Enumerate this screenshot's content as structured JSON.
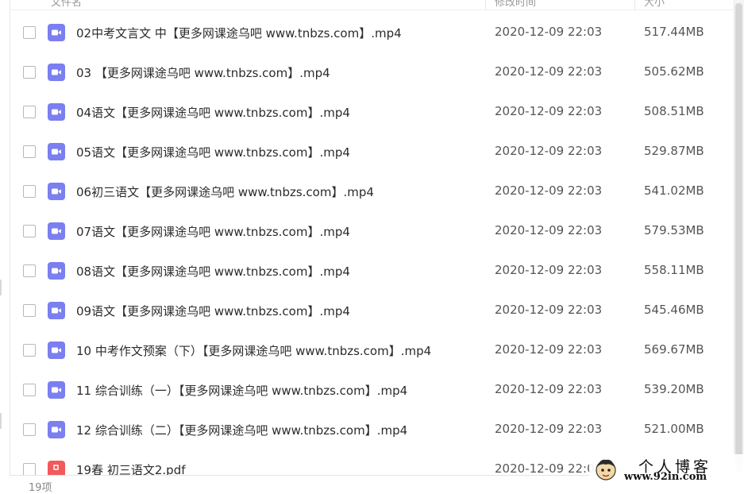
{
  "header": {
    "name_label": "文件名",
    "date_label": "修改时间",
    "size_label": "大小"
  },
  "files": [
    {
      "name": "02中考文言文 中【更多网课途乌吧 www.tnbzs.com】.mp4",
      "date": "2020-12-09 22:03",
      "size": "517.44MB",
      "type": "video"
    },
    {
      "name": "03 【更多网课途乌吧 www.tnbzs.com】.mp4",
      "date": "2020-12-09 22:03",
      "size": "505.62MB",
      "type": "video"
    },
    {
      "name": "04语文【更多网课途乌吧 www.tnbzs.com】.mp4",
      "date": "2020-12-09 22:03",
      "size": "508.51MB",
      "type": "video"
    },
    {
      "name": "05语文【更多网课途乌吧 www.tnbzs.com】.mp4",
      "date": "2020-12-09 22:03",
      "size": "529.87MB",
      "type": "video"
    },
    {
      "name": "06初三语文【更多网课途乌吧 www.tnbzs.com】.mp4",
      "date": "2020-12-09 22:03",
      "size": "541.02MB",
      "type": "video"
    },
    {
      "name": "07语文【更多网课途乌吧 www.tnbzs.com】.mp4",
      "date": "2020-12-09 22:03",
      "size": "579.53MB",
      "type": "video"
    },
    {
      "name": "08语文【更多网课途乌吧 www.tnbzs.com】.mp4",
      "date": "2020-12-09 22:03",
      "size": "558.11MB",
      "type": "video"
    },
    {
      "name": "09语文【更多网课途乌吧 www.tnbzs.com】.mp4",
      "date": "2020-12-09 22:03",
      "size": "545.46MB",
      "type": "video"
    },
    {
      "name": "10 中考作文预案（下）【更多网课途乌吧 www.tnbzs.com】.mp4",
      "date": "2020-12-09 22:03",
      "size": "569.67MB",
      "type": "video"
    },
    {
      "name": "11 综合训练（一）【更多网课途乌吧 www.tnbzs.com】.mp4",
      "date": "2020-12-09 22:03",
      "size": "539.20MB",
      "type": "video"
    },
    {
      "name": "12 综合训练（二）【更多网课途乌吧 www.tnbzs.com】.mp4",
      "date": "2020-12-09 22:03",
      "size": "521.00MB",
      "type": "video"
    },
    {
      "name": "19春 初三语文2.pdf",
      "date": "2020-12-09 22:03",
      "size": "",
      "type": "pdf"
    }
  ],
  "footer": {
    "count": "19项"
  },
  "watermark": {
    "title": "个人博客",
    "url": "www.92in.com"
  },
  "icons": {
    "video": "video-file-icon",
    "pdf": "pdf-file-icon"
  },
  "colors": {
    "video_icon": "#7b7ff0",
    "pdf_icon": "#f25a5a",
    "text": "#2b2b2b",
    "muted": "#555555"
  }
}
